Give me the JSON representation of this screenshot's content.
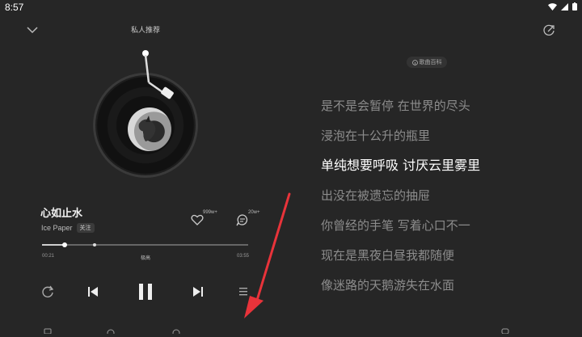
{
  "status_bar": {
    "time": "8:57"
  },
  "header": {
    "title": "私人推荐"
  },
  "song": {
    "title": "心如止水",
    "artist": "Ice Paper",
    "follow_label": "关注",
    "like_count": "999w+",
    "comment_count": "20w+"
  },
  "progress": {
    "current_time": "00:21",
    "total_time": "03:55",
    "quality": "极高",
    "played_fraction": 0.11,
    "buffered_fraction": 0.255
  },
  "lyrics": {
    "wiki_label": "歌曲百科",
    "lines": [
      "是不是会暂停 在世界的尽头",
      "浸泡在十公升的瓶里",
      "单纯想要呼吸 讨厌云里雾里",
      "出没在被遗忘的抽屉",
      "你曾经的手笔 写着心口不一",
      "现在是黑夜白昼我都随便",
      "像迷路的天鹅游失在水面"
    ],
    "active_index": 2
  },
  "icons": {
    "collapse": "chevron-down-icon",
    "share": "share-icon",
    "like": "heart-icon",
    "comment": "comment-icon",
    "loop": "repeat-icon",
    "prev": "previous-icon",
    "play": "pause-icon",
    "next": "next-icon",
    "playlist": "playlist-icon"
  },
  "colors": {
    "background": "#262626",
    "lyric_active": "#ffffff",
    "lyric_inactive": "#8c8c8c",
    "annotation_arrow": "#e8333a"
  }
}
